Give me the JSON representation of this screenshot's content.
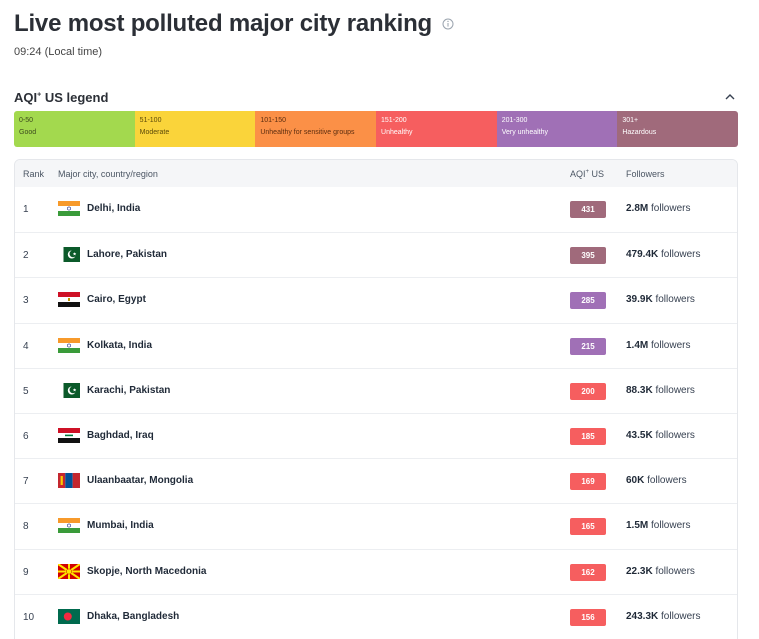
{
  "page": {
    "title": "Live most polluted major city ranking",
    "local_time": "09:24 (Local time)"
  },
  "legend": {
    "title": "AQI",
    "title_sup": "+",
    "title_suffix": " US legend",
    "segments": [
      {
        "range": "0-50",
        "label": "Good",
        "color": "#a3d94e",
        "text_color": "#3c4a1e"
      },
      {
        "range": "51-100",
        "label": "Moderate",
        "color": "#fad43a",
        "text_color": "#5c4a0a"
      },
      {
        "range": "101-150",
        "label": "Unhealthy for sensitive groups",
        "color": "#fb9047",
        "text_color": "#5c2e10"
      },
      {
        "range": "151-200",
        "label": "Unhealthy",
        "color": "#f65e5f",
        "text_color": "#ffffff"
      },
      {
        "range": "201-300",
        "label": "Very unhealthy",
        "color": "#a070b6",
        "text_color": "#ffffff"
      },
      {
        "range": "301+",
        "label": "Hazardous",
        "color": "#a06a7b",
        "text_color": "#ffffff"
      }
    ]
  },
  "table": {
    "headers": {
      "rank": "Rank",
      "city": "Major city, country/region",
      "aqi": "AQI",
      "aqi_sup": "+",
      "aqi_suffix": " US",
      "followers": "Followers"
    },
    "followers_word": "followers",
    "rows": [
      {
        "rank": "1",
        "city": "Delhi, India",
        "aqi": "431",
        "aqi_color": "#a06a7b",
        "followers_count": "2.8M",
        "flag": "india-flag"
      },
      {
        "rank": "2",
        "city": "Lahore, Pakistan",
        "aqi": "395",
        "aqi_color": "#a06a7b",
        "followers_count": "479.4K",
        "flag": "pakistan-flag"
      },
      {
        "rank": "3",
        "city": "Cairo, Egypt",
        "aqi": "285",
        "aqi_color": "#a070b6",
        "followers_count": "39.9K",
        "flag": "egypt-flag"
      },
      {
        "rank": "4",
        "city": "Kolkata, India",
        "aqi": "215",
        "aqi_color": "#a070b6",
        "followers_count": "1.4M",
        "flag": "india-flag"
      },
      {
        "rank": "5",
        "city": "Karachi, Pakistan",
        "aqi": "200",
        "aqi_color": "#f65e5f",
        "followers_count": "88.3K",
        "flag": "pakistan-flag"
      },
      {
        "rank": "6",
        "city": "Baghdad, Iraq",
        "aqi": "185",
        "aqi_color": "#f65e5f",
        "followers_count": "43.5K",
        "flag": "iraq-flag"
      },
      {
        "rank": "7",
        "city": "Ulaanbaatar, Mongolia",
        "aqi": "169",
        "aqi_color": "#f65e5f",
        "followers_count": "60K",
        "flag": "mongolia-flag"
      },
      {
        "rank": "8",
        "city": "Mumbai, India",
        "aqi": "165",
        "aqi_color": "#f65e5f",
        "followers_count": "1.5M",
        "flag": "india-flag"
      },
      {
        "rank": "9",
        "city": "Skopje, North Macedonia",
        "aqi": "162",
        "aqi_color": "#f65e5f",
        "followers_count": "22.3K",
        "flag": "north-macedonia-flag"
      },
      {
        "rank": "10",
        "city": "Dhaka, Bangladesh",
        "aqi": "156",
        "aqi_color": "#f65e5f",
        "followers_count": "243.3K",
        "flag": "bangladesh-flag"
      }
    ]
  }
}
